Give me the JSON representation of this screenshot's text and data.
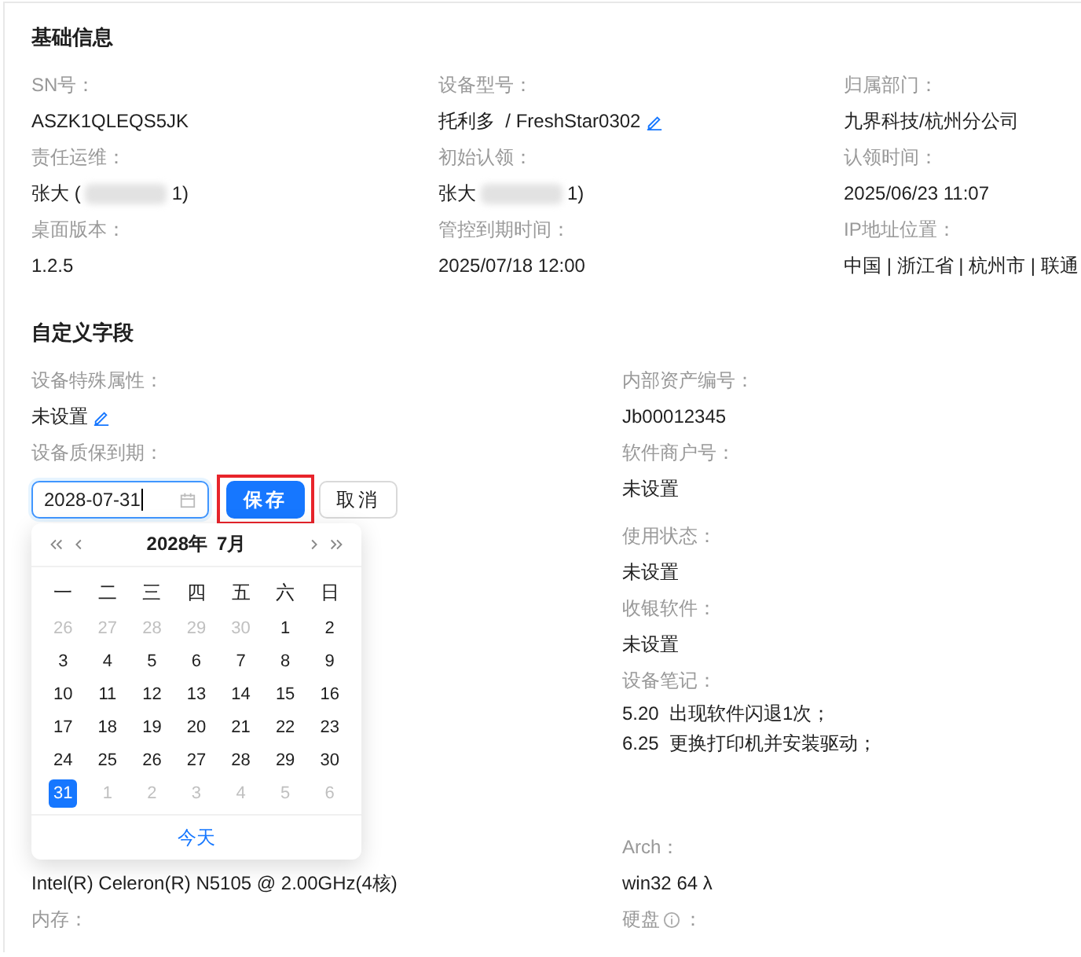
{
  "basic_info": {
    "title": "基础信息",
    "fields": [
      {
        "label": "SN号：",
        "kind": "text",
        "value": "ASZK1QLEQS5JK"
      },
      {
        "label": "设备型号：",
        "kind": "editable",
        "value": "托利多  / FreshStar0302"
      },
      {
        "label": "归属部门：",
        "kind": "text",
        "value": "九界科技/杭州分公司"
      },
      {
        "label": "责任运维：",
        "kind": "masked",
        "prefix": "张大 (",
        "suffix": "1)"
      },
      {
        "label": "初始认领：",
        "kind": "masked",
        "prefix": "张大",
        "suffix": "1)"
      },
      {
        "label": "认领时间：",
        "kind": "text",
        "value": "2025/06/23 11:07"
      },
      {
        "label": "桌面版本：",
        "kind": "text",
        "value": "1.2.5"
      },
      {
        "label": "管控到期时间：",
        "kind": "text",
        "value": "2025/07/18 12:00"
      },
      {
        "label": "IP地址位置：",
        "kind": "text",
        "value": "中国 | 浙江省 | 杭州市 | 联通"
      }
    ]
  },
  "custom_fields": {
    "title": "自定义字段",
    "left": [
      {
        "label": "设备特殊属性：",
        "kind": "editable",
        "value": "未设置"
      },
      {
        "label": "设备质保到期：",
        "kind": "date_edit",
        "value": "2028-07-31",
        "buttons": [
          {
            "label": "保存",
            "primary": true,
            "highlighted": true
          },
          {
            "label": "取消",
            "primary": false,
            "highlighted": false
          }
        ]
      }
    ],
    "right": [
      {
        "label": "内部资产编号：",
        "kind": "text",
        "value": "Jb00012345"
      },
      {
        "label": "软件商户号：",
        "kind": "text",
        "value": "未设置"
      },
      {
        "label": "使用状态：",
        "kind": "text",
        "value": "未设置"
      },
      {
        "label": "收银软件：",
        "kind": "text",
        "value": "未设置"
      },
      {
        "label": "设备笔记：",
        "kind": "lines",
        "lines": [
          "5.20  出现软件闪退1次；",
          "6.25  更换打印机并安装驱动；"
        ]
      }
    ]
  },
  "hardware": {
    "left": [
      {
        "kind": "value_only",
        "value": "Intel(R) Celeron(R) N5105 @ 2.00GHz(4核)"
      },
      {
        "kind": "label_only",
        "label": "内存："
      }
    ],
    "right": [
      {
        "kind": "text",
        "label": "Arch：",
        "value": "win32 64 λ"
      },
      {
        "kind": "label_info",
        "label": "硬盘",
        "colon": "："
      }
    ]
  },
  "calendar": {
    "year": "2028年",
    "month": "7月",
    "weekdays": [
      "一",
      "二",
      "三",
      "四",
      "五",
      "六",
      "日"
    ],
    "days": [
      {
        "text": "26",
        "in_month": false,
        "selected": false
      },
      {
        "text": "27",
        "in_month": false,
        "selected": false
      },
      {
        "text": "28",
        "in_month": false,
        "selected": false
      },
      {
        "text": "29",
        "in_month": false,
        "selected": false
      },
      {
        "text": "30",
        "in_month": false,
        "selected": false
      },
      {
        "text": "1",
        "in_month": true,
        "selected": false
      },
      {
        "text": "2",
        "in_month": true,
        "selected": false
      },
      {
        "text": "3",
        "in_month": true,
        "selected": false
      },
      {
        "text": "4",
        "in_month": true,
        "selected": false
      },
      {
        "text": "5",
        "in_month": true,
        "selected": false
      },
      {
        "text": "6",
        "in_month": true,
        "selected": false
      },
      {
        "text": "7",
        "in_month": true,
        "selected": false
      },
      {
        "text": "8",
        "in_month": true,
        "selected": false
      },
      {
        "text": "9",
        "in_month": true,
        "selected": false
      },
      {
        "text": "10",
        "in_month": true,
        "selected": false
      },
      {
        "text": "11",
        "in_month": true,
        "selected": false
      },
      {
        "text": "12",
        "in_month": true,
        "selected": false
      },
      {
        "text": "13",
        "in_month": true,
        "selected": false
      },
      {
        "text": "14",
        "in_month": true,
        "selected": false
      },
      {
        "text": "15",
        "in_month": true,
        "selected": false
      },
      {
        "text": "16",
        "in_month": true,
        "selected": false
      },
      {
        "text": "17",
        "in_month": true,
        "selected": false
      },
      {
        "text": "18",
        "in_month": true,
        "selected": false
      },
      {
        "text": "19",
        "in_month": true,
        "selected": false
      },
      {
        "text": "20",
        "in_month": true,
        "selected": false
      },
      {
        "text": "21",
        "in_month": true,
        "selected": false
      },
      {
        "text": "22",
        "in_month": true,
        "selected": false
      },
      {
        "text": "23",
        "in_month": true,
        "selected": false
      },
      {
        "text": "24",
        "in_month": true,
        "selected": false
      },
      {
        "text": "25",
        "in_month": true,
        "selected": false
      },
      {
        "text": "26",
        "in_month": true,
        "selected": false
      },
      {
        "text": "27",
        "in_month": true,
        "selected": false
      },
      {
        "text": "28",
        "in_month": true,
        "selected": false
      },
      {
        "text": "29",
        "in_month": true,
        "selected": false
      },
      {
        "text": "30",
        "in_month": true,
        "selected": false
      },
      {
        "text": "31",
        "in_month": true,
        "selected": true
      },
      {
        "text": "1",
        "in_month": false,
        "selected": false
      },
      {
        "text": "2",
        "in_month": false,
        "selected": false
      },
      {
        "text": "3",
        "in_month": false,
        "selected": false
      },
      {
        "text": "4",
        "in_month": false,
        "selected": false
      },
      {
        "text": "5",
        "in_month": false,
        "selected": false
      },
      {
        "text": "6",
        "in_month": false,
        "selected": false
      }
    ],
    "today_label": "今天"
  }
}
